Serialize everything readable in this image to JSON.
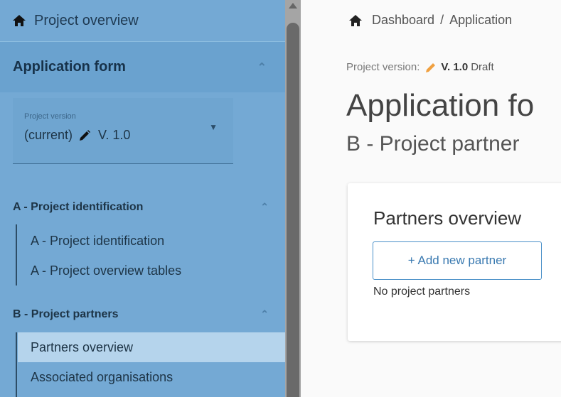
{
  "sidebar": {
    "top_link": "Project overview",
    "section_title": "Application form",
    "version": {
      "label": "Project version",
      "value": "(current)",
      "number": "V. 1.0"
    },
    "groups": [
      {
        "title": "A - Project identification",
        "items": [
          "A - Project identification",
          "A - Project overview tables"
        ]
      },
      {
        "title": "B - Project partners",
        "items": [
          "Partners overview",
          "Associated organisations"
        ]
      }
    ]
  },
  "breadcrumb": {
    "home": "Dashboard",
    "separator": "/",
    "current": "Application"
  },
  "main": {
    "project_version_label": "Project version:",
    "project_version_value": "V. 1.0",
    "project_version_status": "Draft",
    "title": "Application fo",
    "subtitle": "B - Project partner",
    "card": {
      "title": "Partners overview",
      "add_button": "+ Add new partner",
      "empty_text": "No project partners"
    }
  },
  "colors": {
    "sidebar": "#74a9d4",
    "active_item": "#b5d4ec",
    "accent": "#3979b0",
    "pencil_orange": "#f0a040"
  },
  "icons": [
    "home-icon",
    "chevron-up-icon",
    "pencil-icon",
    "caret-down-icon"
  ]
}
